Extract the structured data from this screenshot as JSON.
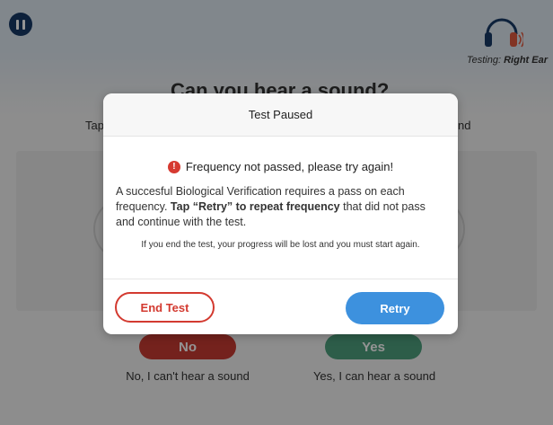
{
  "background": {
    "pause_icon": "pause-icon",
    "headphones_icon": "headphones-right-ear-icon",
    "testing_prefix": "Testing:",
    "testing_ear": "Right Ear",
    "question": "Can you hear a sound?",
    "instruction_left": "Tap",
    "instruction_right": "nd",
    "no_button": "No",
    "yes_button": "Yes",
    "no_caption": "No, I can't hear a sound",
    "yes_caption": "Yes, I can hear a sound"
  },
  "modal": {
    "title": "Test Paused",
    "alert_icon": "exclamation-icon",
    "alert_text": "Frequency not passed, please try again!",
    "explain_part1": "A succesful Biological Verification requires a pass on each frequency. ",
    "explain_bold": "Tap “Retry” to repeat frequency",
    "explain_part2": " that did not pass and continue with the test.",
    "warning": "If you end the test, your progress will be lost and you must start again.",
    "end_button": "End Test",
    "retry_button": "Retry"
  },
  "colors": {
    "pause_bg": "#173a67",
    "no_red": "#c83c32",
    "yes_green": "#4fa07e",
    "retry_blue": "#3d91de",
    "end_red": "#d33a30",
    "alert_red": "#d63a31"
  }
}
